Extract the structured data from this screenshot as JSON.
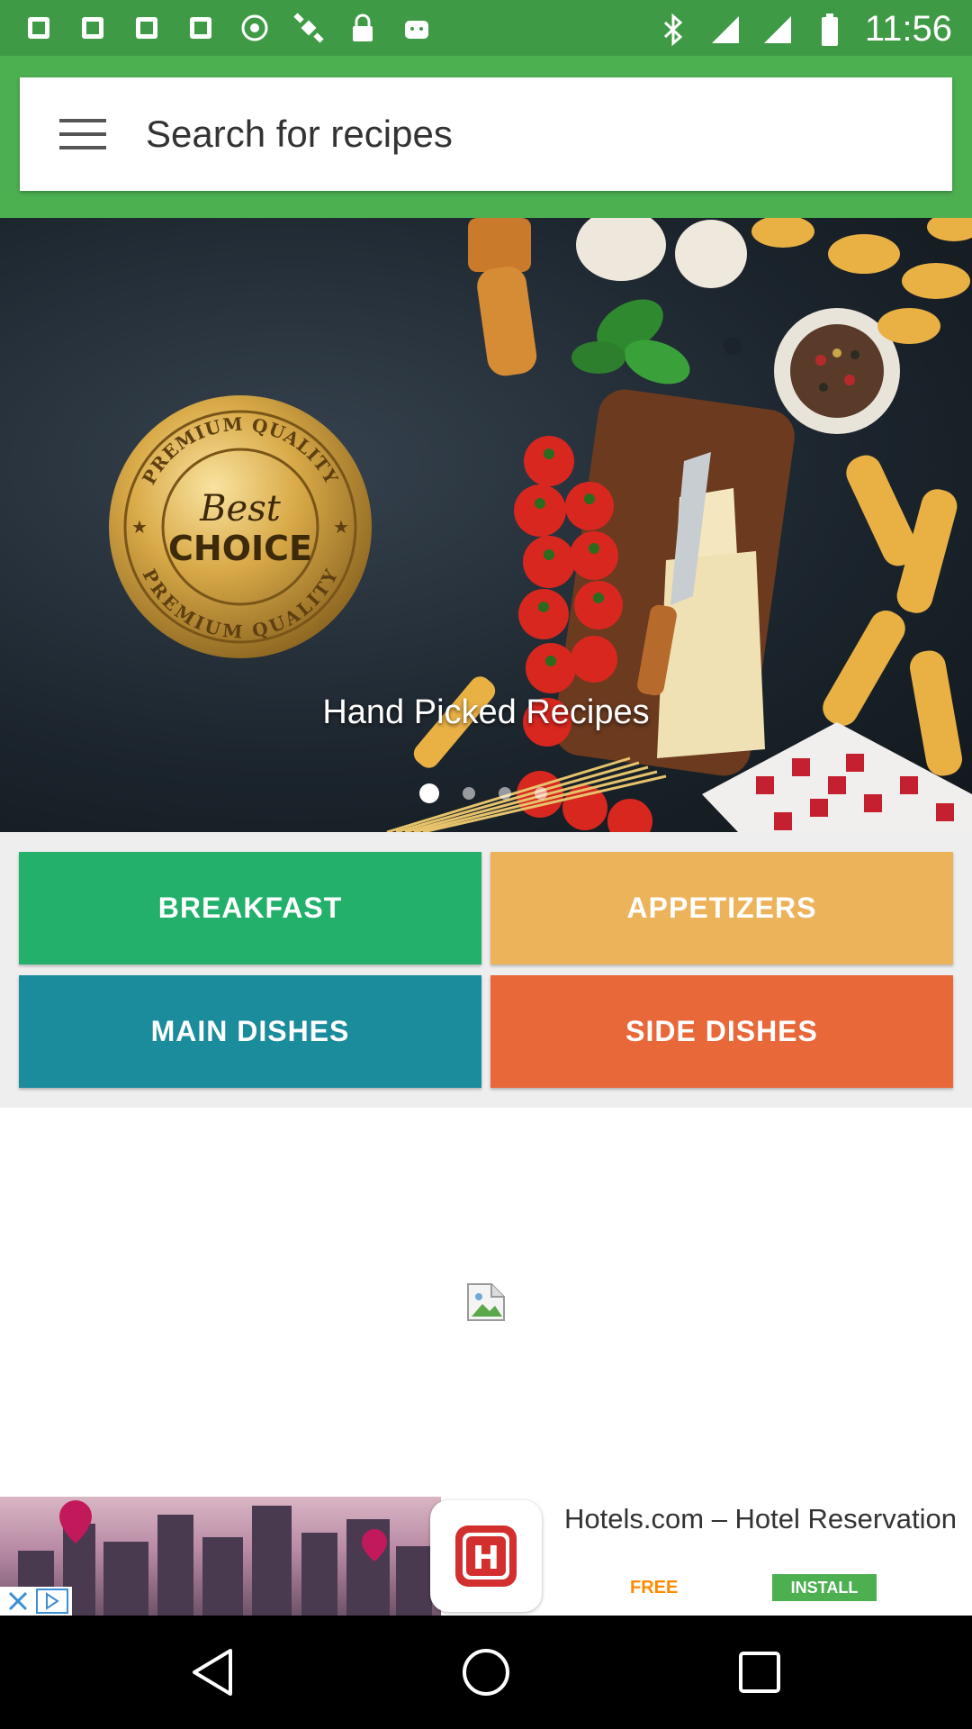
{
  "status_bar": {
    "time": "11:56",
    "left_icons": [
      "app-icon",
      "app-icon",
      "app-icon",
      "app-icon",
      "target-icon",
      "satellite-icon",
      "lock-icon",
      "android-icon"
    ],
    "right_icons": [
      "bluetooth-icon",
      "signal-icon",
      "signal-icon",
      "battery-icon"
    ],
    "color": "#3f9a45"
  },
  "header": {
    "search_placeholder": "Search for recipes",
    "color": "#4caf50"
  },
  "banner": {
    "badge_top": "PREMIUM QUALITY",
    "badge_line1": "Best",
    "badge_line2": "CHOICE",
    "badge_bottom": "PREMIUM QUALITY",
    "caption": "Hand Picked Recipes",
    "pages": 4,
    "active_page": 1
  },
  "categories": {
    "breakfast": "BREAKFAST",
    "appetizers": "APPETIZERS",
    "main_dishes": "MAIN DISHES",
    "side_dishes": "SIDE DISHES",
    "colors": {
      "breakfast": "#22b06b",
      "appetizers": "#ecb35a",
      "main_dishes": "#1a8c9c",
      "side_dishes": "#e8683a"
    }
  },
  "ad": {
    "title": "Hotels.com – Hotel Reservation",
    "free_label": "FREE",
    "install_label": "INSTALL",
    "logo_letter": "H"
  },
  "nav_bar": {
    "buttons": [
      "back-icon",
      "home-icon",
      "recents-icon"
    ]
  }
}
